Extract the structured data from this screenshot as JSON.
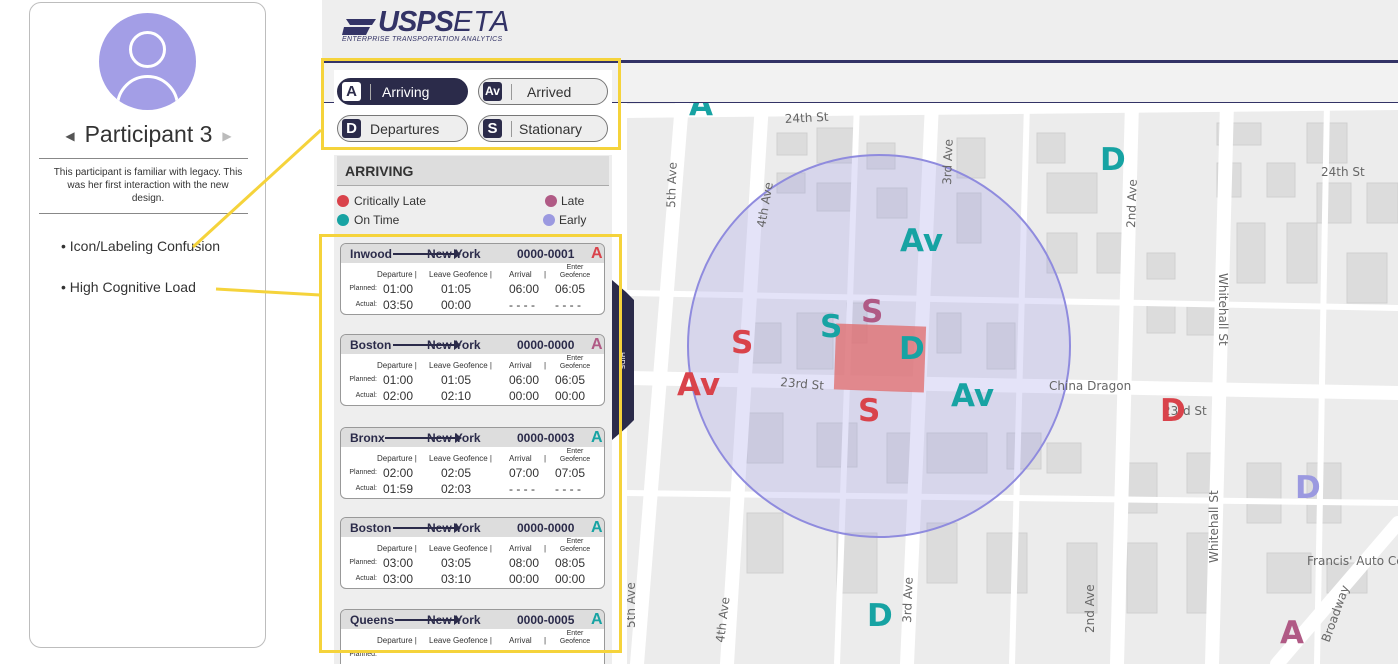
{
  "participant": {
    "name": "Participant 3",
    "description": "This participant is familiar with legacy. This was her first interaction with the new design.",
    "findings": [
      "• Icon/Labeling Confusion",
      "• High Cognitive Load"
    ]
  },
  "app": {
    "logo_main": "USPS",
    "logo_eta": "ETA",
    "logo_sub": "ENTERPRISE TRANSPORTATION ANALYTICS"
  },
  "filters": [
    {
      "letter": "A",
      "label": "Arriving",
      "active": true
    },
    {
      "letter": "Av",
      "label": "Arrived",
      "active": false
    },
    {
      "letter": "D",
      "label": "Departures",
      "active": false
    },
    {
      "letter": "S",
      "label": "Stationary",
      "active": false
    }
  ],
  "section_title": "ARRIVING",
  "legend": {
    "critically_late": {
      "label": "Critically Late",
      "color": "#d9434b"
    },
    "late": {
      "label": "Late",
      "color": "#b05a85"
    },
    "on_time": {
      "label": "On Time",
      "color": "#17a3a3"
    },
    "early": {
      "label": "Early",
      "color": "#9b99e0"
    }
  },
  "columns": {
    "departure": "Departure |",
    "leave_geofence": "Leave Geofence |",
    "arrival": "Arrival",
    "arrival_sep": "|",
    "enter_geofence": "Enter Geofence",
    "planned": "Planned:",
    "actual": "Actual:"
  },
  "trips": [
    {
      "from": "Inwood",
      "to": "New York",
      "id": "0000-0001",
      "status": "A",
      "status_color": "#d9434b",
      "planned": [
        "01:00",
        "01:05",
        "06:00",
        "06:05"
      ],
      "actual": [
        "03:50",
        "00:00",
        "- - - -",
        "- - - -"
      ]
    },
    {
      "from": "Boston",
      "to": "New York",
      "id": "0000-0000",
      "status": "A",
      "status_color": "#b05a85",
      "planned": [
        "01:00",
        "01:05",
        "06:00",
        "06:05"
      ],
      "actual": [
        "02:00",
        "02:10",
        "00:00",
        "00:00"
      ]
    },
    {
      "from": "Bronx",
      "to": "New York",
      "id": "0000-0003",
      "status": "A",
      "status_color": "#17a3a3",
      "planned": [
        "02:00",
        "02:05",
        "07:00",
        "07:05"
      ],
      "actual": [
        "01:59",
        "02:03",
        "- - - -",
        "- - - -"
      ]
    },
    {
      "from": "Boston",
      "to": "New York",
      "id": "0000-0000",
      "status": "A",
      "status_color": "#17a3a3",
      "planned": [
        "03:00",
        "03:05",
        "08:00",
        "08:05"
      ],
      "actual": [
        "03:00",
        "03:10",
        "00:00",
        "00:00"
      ]
    },
    {
      "from": "Queens",
      "to": "New York",
      "id": "0000-0005",
      "status": "A",
      "status_color": "#17a3a3",
      "planned": [
        "",
        "",
        "",
        ""
      ],
      "actual": [
        "",
        "",
        "",
        ""
      ]
    }
  ],
  "hide_label": "HIDE",
  "map": {
    "streets": [
      "24th St",
      "24th St",
      "23rd St",
      "23rd St",
      "5th Ave",
      "4th Ave",
      "3rd Ave",
      "2nd Ave",
      "Whitehall St",
      "Whitehall St",
      "5th Ave",
      "4th Ave",
      "3rd Ave",
      "2nd Ave",
      "Broadway"
    ],
    "places": [
      "China Dragon",
      "Francis' Auto Ce"
    ],
    "markers": [
      {
        "text": "A",
        "color": "#17a3a3"
      },
      {
        "text": "D",
        "color": "#17a3a3"
      },
      {
        "text": "Av",
        "color": "#17a3a3"
      },
      {
        "text": "S",
        "color": "#b05a85"
      },
      {
        "text": "S",
        "color": "#d9434b"
      },
      {
        "text": "S",
        "color": "#17a3a3"
      },
      {
        "text": "D",
        "color": "#17a3a3"
      },
      {
        "text": "Av",
        "color": "#d9434b"
      },
      {
        "text": "Av",
        "color": "#17a3a3"
      },
      {
        "text": "S",
        "color": "#d9434b"
      },
      {
        "text": "D",
        "color": "#d9434b"
      },
      {
        "text": "D",
        "color": "#9b99e0"
      },
      {
        "text": "D",
        "color": "#17a3a3"
      },
      {
        "text": "A",
        "color": "#b05a85"
      }
    ]
  }
}
